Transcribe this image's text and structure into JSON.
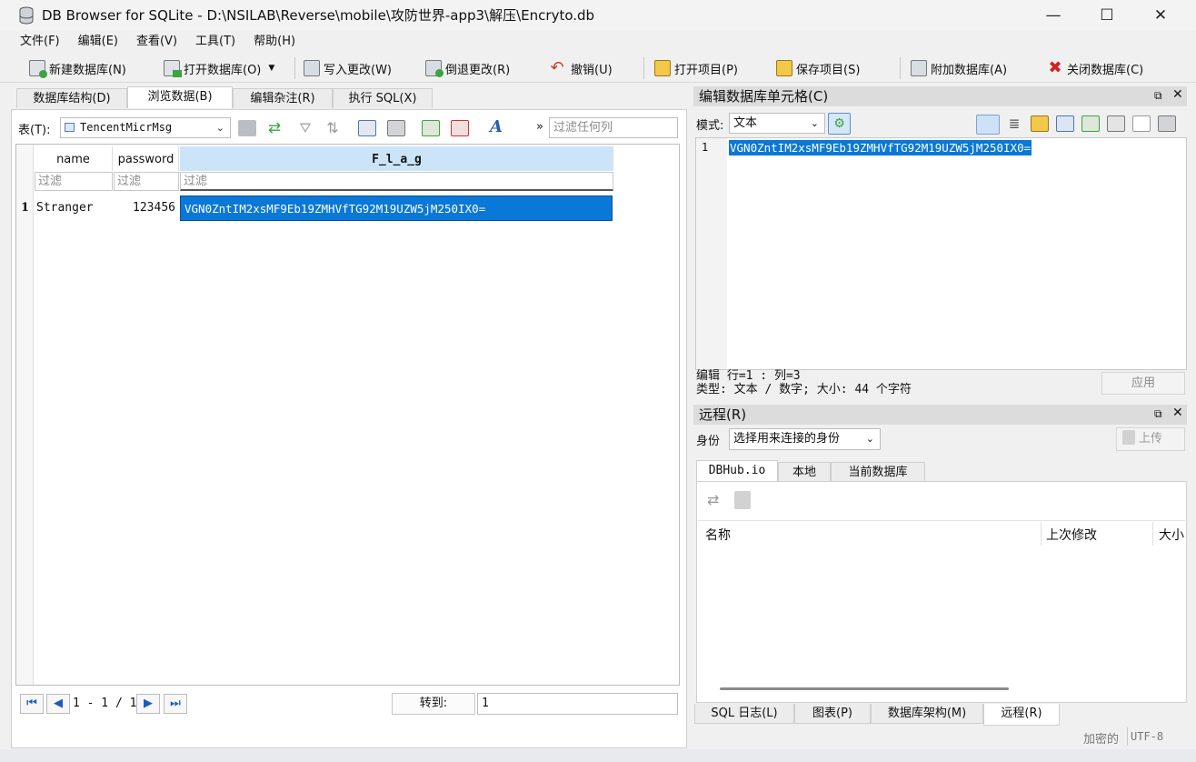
{
  "window": {
    "title": "DB Browser for SQLite - D:\\NSILAB\\Reverse\\mobile\\攻防世界-app3\\解压\\Encryto.db",
    "minimize": "—",
    "maximize": "☐",
    "close": "✕"
  },
  "menu": [
    "文件(F)",
    "编辑(E)",
    "查看(V)",
    "工具(T)",
    "帮助(H)"
  ],
  "toolbar": {
    "new_db": "新建数据库(N)",
    "open_db": "打开数据库(O)",
    "write_changes": "写入更改(W)",
    "revert_changes": "倒退更改(R)",
    "undo": "撤销(U)",
    "open_project": "打开项目(P)",
    "save_project": "保存项目(S)",
    "attach_db": "附加数据库(A)",
    "close_db": "关闭数据库(C)"
  },
  "main_tabs": [
    "数据库结构(D)",
    "浏览数据(B)",
    "编辑杂注(R)",
    "执行 SQL(X)"
  ],
  "browse": {
    "table_label": "表(T):",
    "table_value": "TencentMicrMsg",
    "more": "»",
    "filter_any_placeholder": "过滤任何列",
    "columns": [
      "name",
      "password",
      "F_l_a_g"
    ],
    "filter_placeholder": "过滤",
    "rows": [
      {
        "num": "1",
        "name": "Stranger",
        "password": "123456",
        "flag": "VGN0ZntIM2xsMF9Eb19ZMHVfTG92M19UZW5jM250IX0="
      }
    ]
  },
  "pager": {
    "range": "1 - 1 / 1",
    "goto_label": "转到:",
    "goto_value": "1"
  },
  "edit_cell": {
    "title": "编辑数据库单元格(C)",
    "mode_label": "模式:",
    "mode_value": "文本",
    "line_no": "1",
    "content": "VGN0ZntIM2xsMF9Eb19ZMHVfTG92M19UZW5jM250IX0=",
    "status_line1": "编辑 行=1 : 列=3",
    "status_line2": "类型: 文本 / 数字; 大小: 44 个字符",
    "apply": "应用"
  },
  "remote": {
    "title": "远程(R)",
    "identity_label": "身份",
    "identity_value": "选择用来连接的身份",
    "upload": "上传",
    "tabs": [
      "DBHub.io",
      "本地",
      "当前数据库"
    ],
    "columns": [
      "名称",
      "上次修改",
      "大小"
    ]
  },
  "bottom_tabs": [
    "SQL 日志(L)",
    "图表(P)",
    "数据库架构(M)",
    "远程(R)"
  ],
  "statusbar": {
    "encrypted": "加密的",
    "encoding": "UTF-8"
  }
}
